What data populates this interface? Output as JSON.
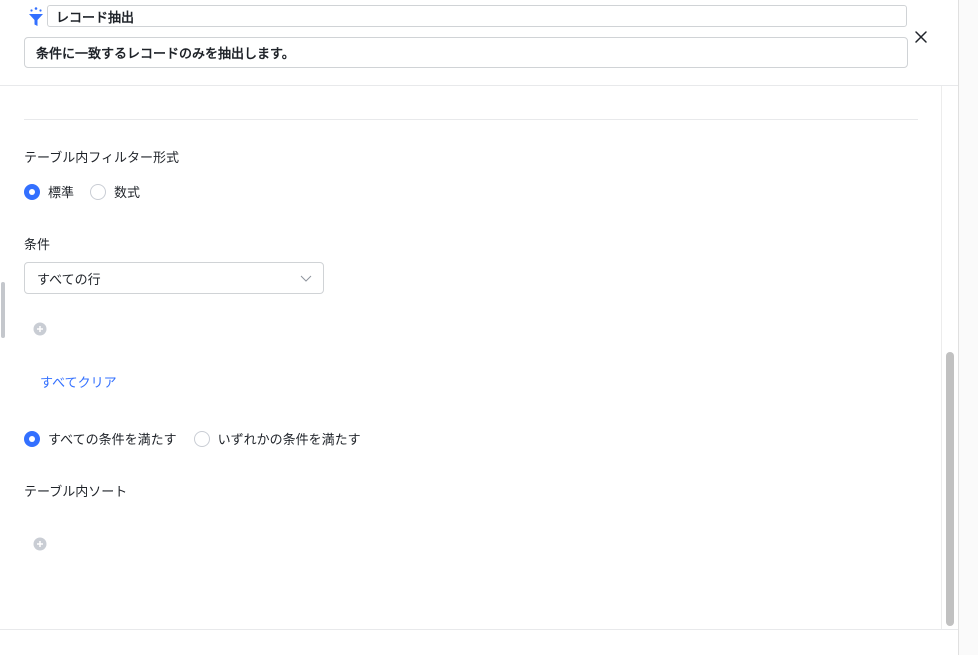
{
  "header": {
    "step_icon": "filter-sparkle-icon",
    "title_value": "レコード抽出",
    "description_value": "条件に一致するレコードのみを抽出します。",
    "close_icon": "close-icon"
  },
  "filter_format": {
    "label": "テーブル内フィルター形式",
    "options": [
      {
        "label": "標準",
        "selected": true
      },
      {
        "label": "数式",
        "selected": false
      }
    ]
  },
  "condition": {
    "label": "条件",
    "select_value": "すべての行",
    "add_icon": "plus-circle-icon",
    "clear_label": "すべてクリア"
  },
  "match_mode": {
    "options": [
      {
        "label": "すべての条件を満たす",
        "selected": true
      },
      {
        "label": "いずれかの条件を満たす",
        "selected": false
      }
    ]
  },
  "sort": {
    "label": "テーブル内ソート",
    "add_icon": "plus-circle-icon"
  },
  "colors": {
    "accent": "#3370ff",
    "text": "#1f2329",
    "border": "#d0d3d6"
  }
}
